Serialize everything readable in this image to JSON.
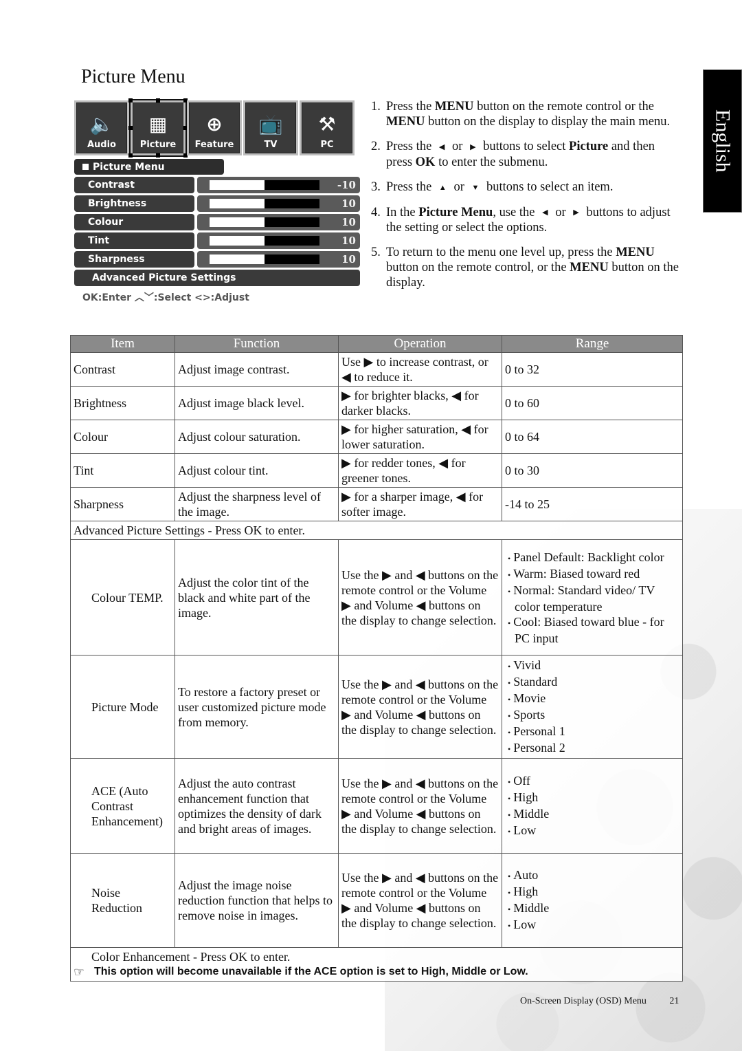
{
  "page": {
    "title": "Picture Menu",
    "language_tab": "English",
    "footer": {
      "section": "On-Screen Display (OSD) Menu",
      "page_number": "21"
    }
  },
  "osd": {
    "tabs": [
      {
        "label": "Audio",
        "icon": "speaker-icon",
        "glyph": "🔈",
        "selected": false
      },
      {
        "label": "Picture",
        "icon": "picture-icon",
        "glyph": "▦",
        "selected": true
      },
      {
        "label": "Feature",
        "icon": "feature-icon",
        "glyph": "⊕",
        "selected": false
      },
      {
        "label": "TV",
        "icon": "tv-icon",
        "glyph": "📺",
        "selected": false
      },
      {
        "label": "PC",
        "icon": "tools-icon",
        "glyph": "⚒",
        "selected": false
      }
    ],
    "header": "Picture Menu",
    "rows": [
      {
        "label": "Contrast",
        "value": "-10",
        "fill_percent": 50
      },
      {
        "label": "Brightness",
        "value": "10",
        "fill_percent": 50
      },
      {
        "label": "Colour",
        "value": "10",
        "fill_percent": 50
      },
      {
        "label": "Tint",
        "value": "10",
        "fill_percent": 50
      },
      {
        "label": "Sharpness",
        "value": "10",
        "fill_percent": 50
      }
    ],
    "advanced": "Advanced Picture Settings",
    "hint": "OK:Enter  ︿﹀:Select <>:Adjust"
  },
  "steps": [
    {
      "num": "1.",
      "html": "Press the <b>MENU</b> button on the remote control or the <b>MENU</b> button on the display to display the main menu."
    },
    {
      "num": "2.",
      "html": "Press the <span class='tri'>◀</span> or <span class='tri'>▶</span> buttons to select <b>Picture</b> and then press <b>OK</b> to enter the submenu."
    },
    {
      "num": "3.",
      "html": "Press the <span class='tri'>▲</span> or <span class='tri'>▼</span> buttons to select an item."
    },
    {
      "num": "4.",
      "html": "In the <b>Picture Menu</b>, use the <span class='tri'>◀</span> or <span class='tri'>▶</span> buttons to adjust the setting or select the options."
    },
    {
      "num": "5.",
      "html": "To return to the menu one level up, press the <b>MENU</b> button on the remote control, or the <b>MENU</b> button on the display."
    }
  ],
  "table": {
    "headers": [
      "Item",
      "Function",
      "Operation",
      "Range"
    ],
    "basic_rows": [
      {
        "item": "Contrast",
        "function": "Adjust image contrast.",
        "operation": "Use ▶ to increase contrast, or ◀ to reduce it.",
        "range": "0 to 32"
      },
      {
        "item": "Brightness",
        "function": "Adjust image black level.",
        "operation": "▶ for brighter blacks, ◀ for darker blacks.",
        "range": "0 to 60"
      },
      {
        "item": "Colour",
        "function": "Adjust colour saturation.",
        "operation": "▶ for higher saturation, ◀ for lower saturation.",
        "range": "0 to 64"
      },
      {
        "item": "Tint",
        "function": "Adjust colour tint.",
        "operation": "▶ for redder tones, ◀ for greener tones.",
        "range": "0 to 30"
      },
      {
        "item": "Sharpness",
        "function": "Adjust the sharpness level of the image.",
        "operation": "▶ for a sharper image, ◀ for softer image.",
        "range": "-14 to 25"
      }
    ],
    "advanced_label": "Advanced Picture Settings - Press OK to enter.",
    "advanced_rows": [
      {
        "item": "Colour TEMP.",
        "function": "Adjust the color tint of the black and white part of the image.",
        "operation": "Use the ▶ and ◀ buttons on the remote control or the Volume ▶ and Volume ◀ buttons on the display to change selection.",
        "options": [
          "Panel Default: Backlight color",
          "Warm: Biased toward red",
          "Normal: Standard video/ TV color temperature",
          "Cool: Biased toward blue - for PC input"
        ]
      },
      {
        "item": "Picture Mode",
        "function": "To restore a factory preset or user customized picture mode from memory.",
        "operation": "Use the ▶ and ◀ buttons on the remote control or the Volume ▶ and Volume ◀ buttons on the display to change selection.",
        "options": [
          "Vivid",
          "Standard",
          "Movie",
          "Sports",
          "Personal 1",
          "Personal 2"
        ]
      },
      {
        "item": "ACE (Auto Contrast Enhancement)",
        "function": "Adjust the auto contrast enhancement function that optimizes the density of dark and bright areas of images.",
        "operation": "Use the ▶ and ◀ buttons on the remote control or the Volume ▶ and Volume ◀ buttons on the display to change selection.",
        "options": [
          "Off",
          "High",
          "Middle",
          "Low"
        ]
      },
      {
        "item": "Noise Reduction",
        "function": "Adjust the image noise reduction function that helps to remove noise in images.",
        "operation": "Use the ▶ and ◀ buttons on the remote control or the Volume ▶ and Volume ◀ buttons on the display to change selection.",
        "options": [
          "Auto",
          "High",
          "Middle",
          "Low"
        ]
      }
    ],
    "color_enhancement_label": "Color Enhancement - Press OK to enter.",
    "note": "This option will become unavailable if the ACE option is set to High, Middle or Low.",
    "note_icon": "☞"
  }
}
